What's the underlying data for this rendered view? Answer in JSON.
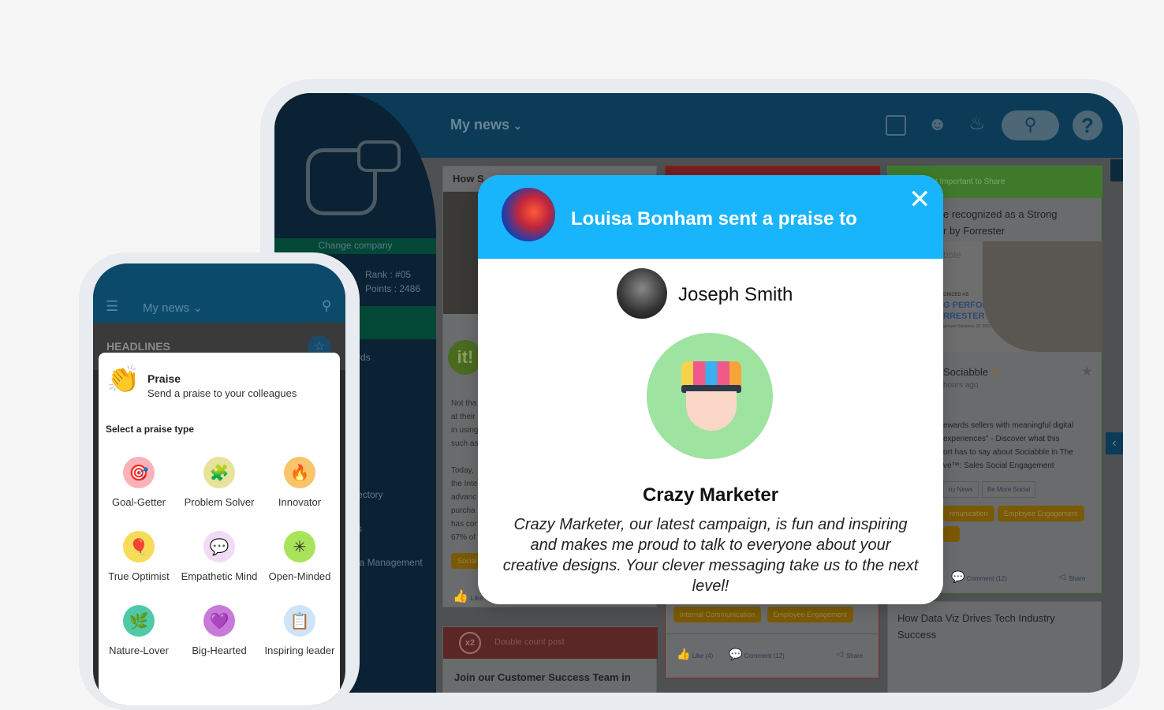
{
  "tablet": {
    "header": {
      "title": "My news"
    },
    "sidebar": {
      "change_company": "Change company",
      "rank": "Rank  : #05",
      "points": "Points : 2486",
      "items": [
        "rds",
        "ectory",
        "s",
        "ia Management",
        "t"
      ]
    },
    "feed": {
      "left_card": {
        "title": "How S",
        "body": [
          "Not tha",
          "at their",
          "in using",
          "such as",
          "",
          "Today,",
          "the Inte",
          "advanc",
          "purcha",
          "has cor",
          "67% of"
        ],
        "tag": "Social",
        "like": "Like"
      },
      "double_card": {
        "badge": "x2",
        "label": "Double count post",
        "title": "Join our Customer Success Team in"
      },
      "middle_card": {
        "tags": [
          "Internal Communication",
          "Employee Engagement"
        ],
        "like": "Like (4)",
        "comment": "Comment (12)",
        "share": "Share"
      },
      "right_card": {
        "header": "t Important to Share",
        "title": "e recognized as a Strong\nr by Forrester",
        "image_text": [
          "bble",
          "GNIZED AS",
          "G PERFORMER",
          "RRESTER WAVE™:",
          "gement Solutions, Q1 2021"
        ],
        "author": "Sociabble",
        "time": "hours ago",
        "body": "ewards sellers with meaningful digital\nexperiences\" - Discover what this\nort has to say about Sociabble in The\nve™: Sales Social Engagement",
        "channels": [
          "ny News",
          "Be More Social"
        ],
        "tags": [
          "nmunication",
          "Employee Engagement",
          "g"
        ],
        "comment": "Comment (12)",
        "share": "Share"
      },
      "right_card2": {
        "title": "How Data Viz Drives Tech Industry Success"
      }
    }
  },
  "modal": {
    "sender_title": "Louisa Bonham sent a praise to",
    "recipient": "Joseph Smith",
    "badge_name": "Crazy Marketer",
    "message": "Crazy Marketer, our latest campaign, is fun and inspiring and makes me proud to talk to everyone about your creative designs. Your clever messaging take us to the next level!",
    "accent": "#19b5fc"
  },
  "phone": {
    "header": {
      "title": "My news"
    },
    "headlines": "HEADLINES",
    "praise": {
      "title": "Praise",
      "subtitle": "Send a praise to your colleagues",
      "select_label": "Select a praise type",
      "types": [
        {
          "label": "Goal-Getter",
          "icon": "target-icon",
          "color": "#f9b3b8"
        },
        {
          "label": "Problem Solver",
          "icon": "puzzle-icon",
          "color": "#e8e39a"
        },
        {
          "label": "Innovator",
          "icon": "flame-pencil-icon",
          "color": "#f9c46a"
        },
        {
          "label": "True Optimist",
          "icon": "balloon-icon",
          "color": "#f7dc5a"
        },
        {
          "label": "Empathetic Mind",
          "icon": "heart-bubble-icon",
          "color": "#f0dcf4"
        },
        {
          "label": "Open-Minded",
          "icon": "sparkle-icon",
          "color": "#a8e35a"
        },
        {
          "label": "Nature-Lover",
          "icon": "leaf-icon",
          "color": "#4fc9a8"
        },
        {
          "label": "Big-Hearted",
          "icon": "heart-icon",
          "color": "#c77ad9"
        },
        {
          "label": "Inspiring leader",
          "icon": "board-icon",
          "color": "#cfe4f7"
        }
      ]
    }
  }
}
